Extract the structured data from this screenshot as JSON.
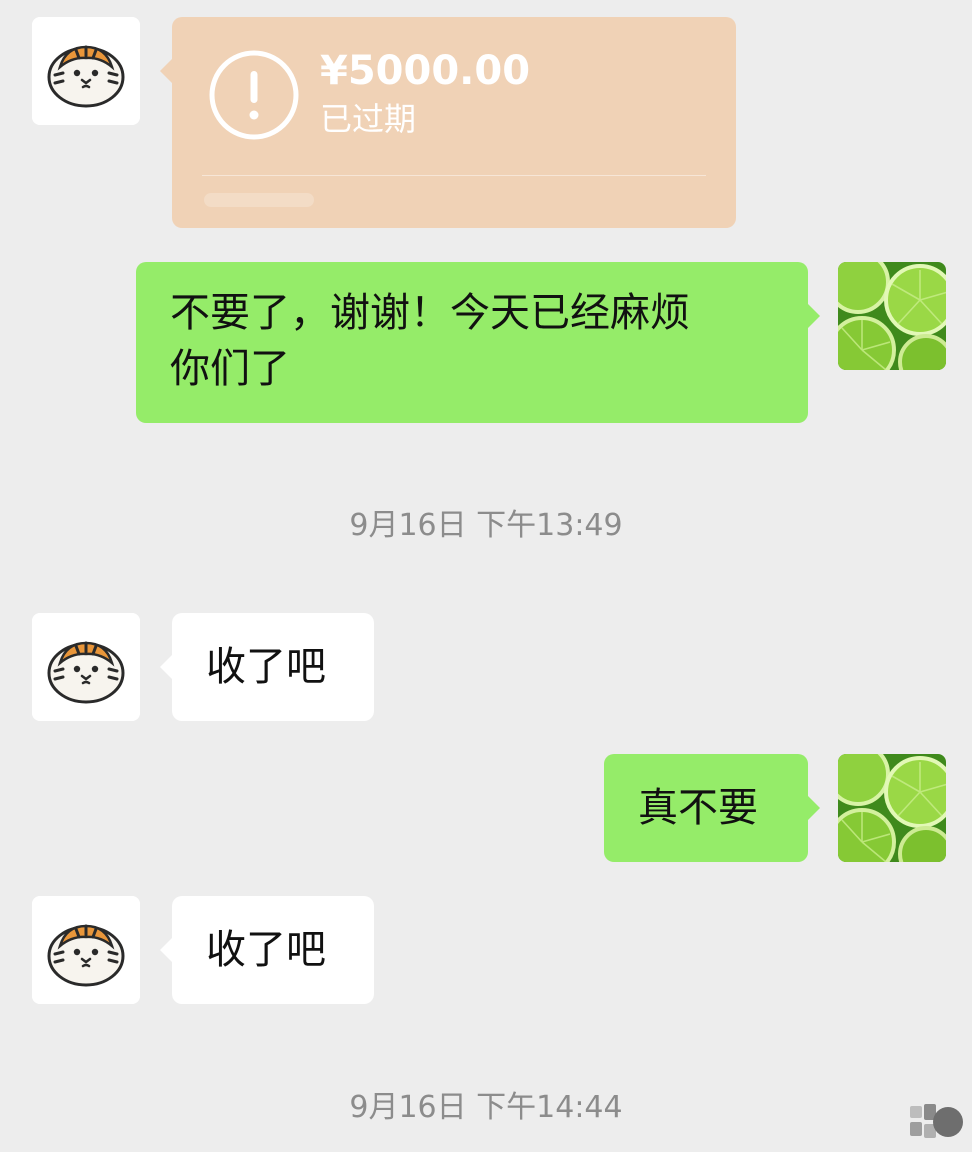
{
  "colors": {
    "background": "#ededed",
    "bubble_sent": "#95ec69",
    "bubble_received": "#ffffff",
    "transfer_card": "#f0d2b6",
    "timestamp_text": "#8c8c8c"
  },
  "contact": {
    "avatar_icon": "tiger-avatar-icon"
  },
  "self": {
    "avatar_icon": "lime-avatar-icon"
  },
  "messages": [
    {
      "type": "transfer",
      "from": "contact",
      "amount": "¥5000.00",
      "status": "已过期"
    },
    {
      "type": "text",
      "from": "self",
      "line1": "不要了，谢谢！今天已经麻烦",
      "line2": "你们了"
    },
    {
      "type": "timestamp",
      "text": "9月16日 下午13:49"
    },
    {
      "type": "text",
      "from": "contact",
      "text": "收了吧"
    },
    {
      "type": "text",
      "from": "self",
      "text": "真不要"
    },
    {
      "type": "text",
      "from": "contact",
      "text": "收了吧"
    },
    {
      "type": "timestamp",
      "text": "9月16日 下午14:44"
    }
  ]
}
